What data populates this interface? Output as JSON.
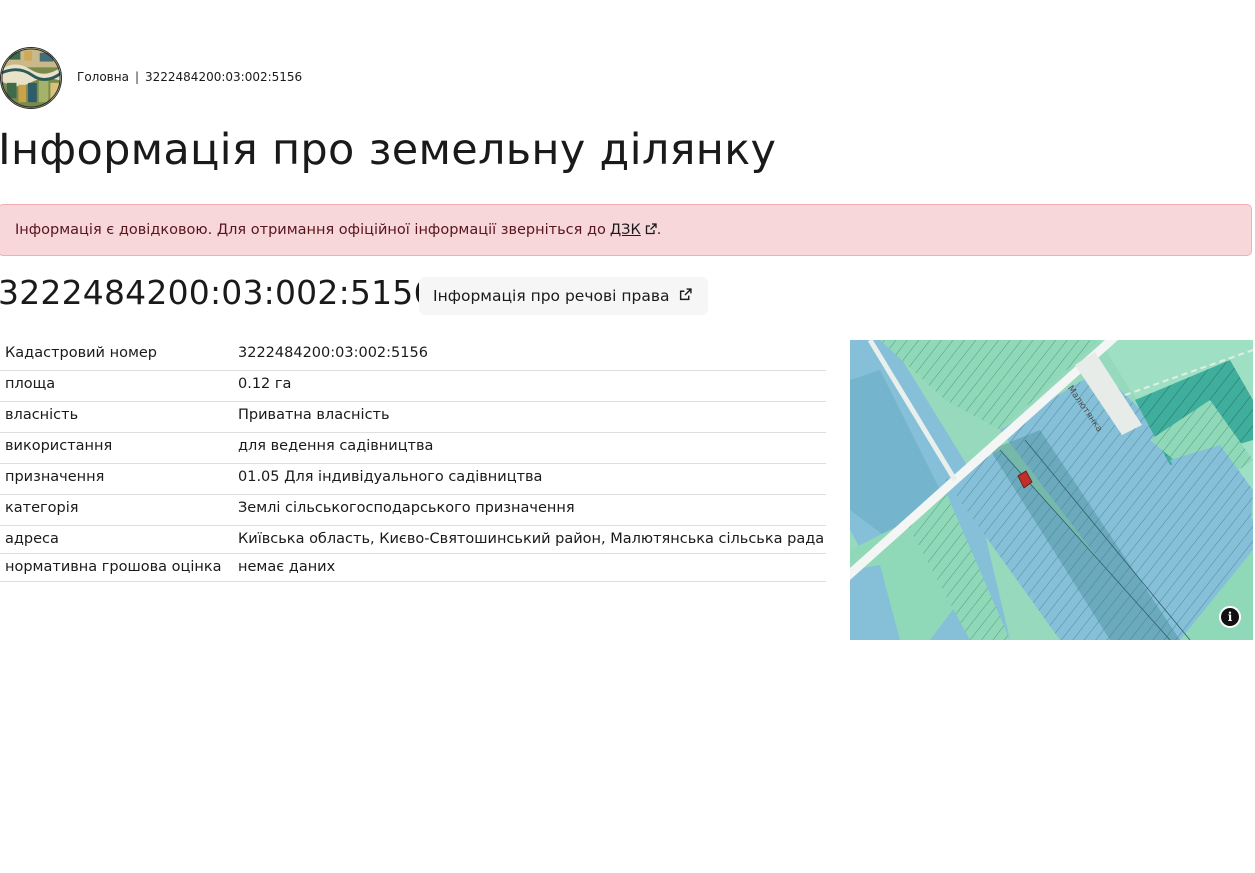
{
  "breadcrumb": {
    "home": "Головна",
    "current": "3222484200:03:002:5156"
  },
  "page_title": "Інформація про земельну ділянку",
  "alert": {
    "text": "Інформація є довідковою. Для отримання офіційної інформації зверніться до",
    "link": "ДЗК",
    "tail": "."
  },
  "cadastral_number": "3222484200:03:002:5156",
  "rights_button_label": "Інформація про речові права",
  "details": [
    {
      "key": "Кадастровий номер",
      "value": "3222484200:03:002:5156"
    },
    {
      "key": "площа",
      "value": "0.12 га"
    },
    {
      "key": "власність",
      "value": "Приватна власність"
    },
    {
      "key": "використання",
      "value": "для ведення садівництва"
    },
    {
      "key": "призначення",
      "value": "01.05 Для індивідуального садівництва"
    },
    {
      "key": "категорія",
      "value": "Землі сільськогосподарського призначення"
    },
    {
      "key": "адреса",
      "value": "Київська область, Києво-Святошинський район, Малютянська сільська рада"
    },
    {
      "key": "нормативна грошова оцінка",
      "value": "немає даних"
    }
  ],
  "map": {
    "street_label": "Малютянка",
    "info_icon": "info-icon",
    "colors": {
      "green_parcel": "#8fd9b8",
      "blue_parcel": "#86c0d8",
      "teal_parcel": "#4fb4a5",
      "road": "#f3f6f4",
      "selected_parcel": "#c0302b"
    }
  }
}
